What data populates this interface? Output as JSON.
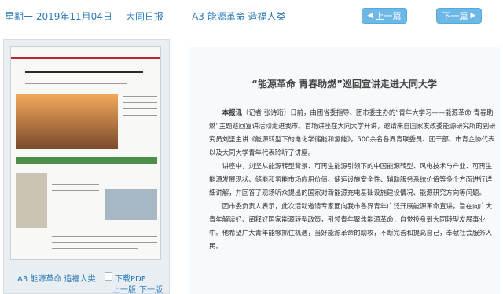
{
  "header": {
    "date": "星期一 2019年11月04日",
    "paper": "大同日报",
    "section": "-A3 能源革命 造福人类-",
    "prev_label": "上一篇",
    "next_label": "下一篇",
    "accent": "#6cb8e6"
  },
  "thumbnail": {
    "caption": "A3 能源革命 造福人类",
    "download_label": "下载PDF",
    "prev_page": "上一版",
    "next_page": "下一版"
  },
  "article": {
    "title": "“能源革命 青春助燃”巡回宣讲走进大同大学",
    "lead": "本报讯",
    "paragraphs": [
      "（记者 张诗珩）日前，由团省委指导、团市委主办的“青年大学习——能源革命 青春助燃”主题巡回宣讲活动走进我市。首场讲座在大同大学开讲，邀请来自国家发改委能源研究所的副研究员刘坚主讲《能源转型下的电化学储能和氢能》，500余名各界青联委员、团干部、市青企协代表以及大同大学青年代表聆听了讲座。",
      "讲座中，刘坚从能源转型背景、可再生能源引领下的中国能源转型、风电技术与产业、可再生能源发展现状、储能和氢能市场应用价值、储运设施安全性、辅助服务系统价值等多个方面进行详细讲解，并回答了现场听众提出的国家对新能源充电基础设施建设情况、能源研究方向等问题。",
      "团市委负责人表示，此次活动邀请专家面向我市各界青年广泛开展能源革命宣讲，旨在向广大青年解读好、阐释好国家能源转型政策，引领青年聚焦能源革命，自觉投身到大同转型发展事业中。他希望广大青年能够抓住机遇，当好能源革命的助攻，不断完善和提高自己，奉献社会服务人民。"
    ]
  }
}
